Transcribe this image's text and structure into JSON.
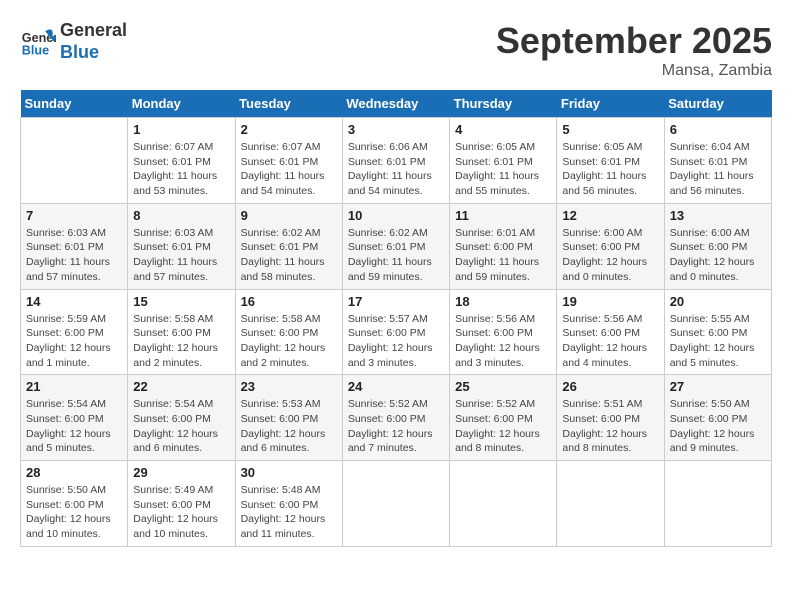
{
  "logo": {
    "line1": "General",
    "line2": "Blue"
  },
  "title": "September 2025",
  "subtitle": "Mansa, Zambia",
  "days_of_week": [
    "Sunday",
    "Monday",
    "Tuesday",
    "Wednesday",
    "Thursday",
    "Friday",
    "Saturday"
  ],
  "weeks": [
    [
      {
        "day": "",
        "info": ""
      },
      {
        "day": "1",
        "info": "Sunrise: 6:07 AM\nSunset: 6:01 PM\nDaylight: 11 hours\nand 53 minutes."
      },
      {
        "day": "2",
        "info": "Sunrise: 6:07 AM\nSunset: 6:01 PM\nDaylight: 11 hours\nand 54 minutes."
      },
      {
        "day": "3",
        "info": "Sunrise: 6:06 AM\nSunset: 6:01 PM\nDaylight: 11 hours\nand 54 minutes."
      },
      {
        "day": "4",
        "info": "Sunrise: 6:05 AM\nSunset: 6:01 PM\nDaylight: 11 hours\nand 55 minutes."
      },
      {
        "day": "5",
        "info": "Sunrise: 6:05 AM\nSunset: 6:01 PM\nDaylight: 11 hours\nand 56 minutes."
      },
      {
        "day": "6",
        "info": "Sunrise: 6:04 AM\nSunset: 6:01 PM\nDaylight: 11 hours\nand 56 minutes."
      }
    ],
    [
      {
        "day": "7",
        "info": "Sunrise: 6:03 AM\nSunset: 6:01 PM\nDaylight: 11 hours\nand 57 minutes."
      },
      {
        "day": "8",
        "info": "Sunrise: 6:03 AM\nSunset: 6:01 PM\nDaylight: 11 hours\nand 57 minutes."
      },
      {
        "day": "9",
        "info": "Sunrise: 6:02 AM\nSunset: 6:01 PM\nDaylight: 11 hours\nand 58 minutes."
      },
      {
        "day": "10",
        "info": "Sunrise: 6:02 AM\nSunset: 6:01 PM\nDaylight: 11 hours\nand 59 minutes."
      },
      {
        "day": "11",
        "info": "Sunrise: 6:01 AM\nSunset: 6:00 PM\nDaylight: 11 hours\nand 59 minutes."
      },
      {
        "day": "12",
        "info": "Sunrise: 6:00 AM\nSunset: 6:00 PM\nDaylight: 12 hours\nand 0 minutes."
      },
      {
        "day": "13",
        "info": "Sunrise: 6:00 AM\nSunset: 6:00 PM\nDaylight: 12 hours\nand 0 minutes."
      }
    ],
    [
      {
        "day": "14",
        "info": "Sunrise: 5:59 AM\nSunset: 6:00 PM\nDaylight: 12 hours\nand 1 minute."
      },
      {
        "day": "15",
        "info": "Sunrise: 5:58 AM\nSunset: 6:00 PM\nDaylight: 12 hours\nand 2 minutes."
      },
      {
        "day": "16",
        "info": "Sunrise: 5:58 AM\nSunset: 6:00 PM\nDaylight: 12 hours\nand 2 minutes."
      },
      {
        "day": "17",
        "info": "Sunrise: 5:57 AM\nSunset: 6:00 PM\nDaylight: 12 hours\nand 3 minutes."
      },
      {
        "day": "18",
        "info": "Sunrise: 5:56 AM\nSunset: 6:00 PM\nDaylight: 12 hours\nand 3 minutes."
      },
      {
        "day": "19",
        "info": "Sunrise: 5:56 AM\nSunset: 6:00 PM\nDaylight: 12 hours\nand 4 minutes."
      },
      {
        "day": "20",
        "info": "Sunrise: 5:55 AM\nSunset: 6:00 PM\nDaylight: 12 hours\nand 5 minutes."
      }
    ],
    [
      {
        "day": "21",
        "info": "Sunrise: 5:54 AM\nSunset: 6:00 PM\nDaylight: 12 hours\nand 5 minutes."
      },
      {
        "day": "22",
        "info": "Sunrise: 5:54 AM\nSunset: 6:00 PM\nDaylight: 12 hours\nand 6 minutes."
      },
      {
        "day": "23",
        "info": "Sunrise: 5:53 AM\nSunset: 6:00 PM\nDaylight: 12 hours\nand 6 minutes."
      },
      {
        "day": "24",
        "info": "Sunrise: 5:52 AM\nSunset: 6:00 PM\nDaylight: 12 hours\nand 7 minutes."
      },
      {
        "day": "25",
        "info": "Sunrise: 5:52 AM\nSunset: 6:00 PM\nDaylight: 12 hours\nand 8 minutes."
      },
      {
        "day": "26",
        "info": "Sunrise: 5:51 AM\nSunset: 6:00 PM\nDaylight: 12 hours\nand 8 minutes."
      },
      {
        "day": "27",
        "info": "Sunrise: 5:50 AM\nSunset: 6:00 PM\nDaylight: 12 hours\nand 9 minutes."
      }
    ],
    [
      {
        "day": "28",
        "info": "Sunrise: 5:50 AM\nSunset: 6:00 PM\nDaylight: 12 hours\nand 10 minutes."
      },
      {
        "day": "29",
        "info": "Sunrise: 5:49 AM\nSunset: 6:00 PM\nDaylight: 12 hours\nand 10 minutes."
      },
      {
        "day": "30",
        "info": "Sunrise: 5:48 AM\nSunset: 6:00 PM\nDaylight: 12 hours\nand 11 minutes."
      },
      {
        "day": "",
        "info": ""
      },
      {
        "day": "",
        "info": ""
      },
      {
        "day": "",
        "info": ""
      },
      {
        "day": "",
        "info": ""
      }
    ]
  ]
}
